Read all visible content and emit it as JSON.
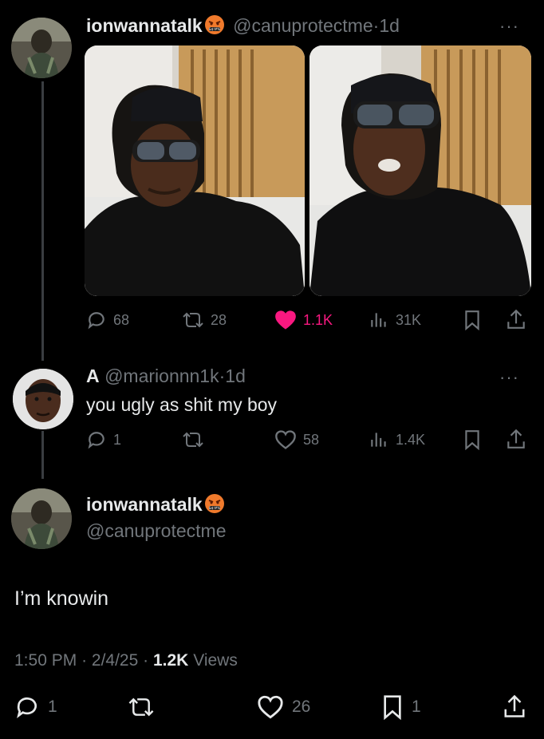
{
  "tweet1": {
    "display_name": "ionwannatalk",
    "handle": "@canuprotectme",
    "age": "1d",
    "more": "···",
    "stats": {
      "replies": "68",
      "retweets": "28",
      "likes": "1.1K",
      "views": "31K"
    }
  },
  "reply": {
    "display_name": "A",
    "handle": "@marionnn1k",
    "age": "1d",
    "more": "···",
    "text": "you ugly as shit my boy",
    "stats": {
      "replies": "1",
      "retweets": "",
      "likes": "58",
      "views": "1.4K"
    }
  },
  "main": {
    "display_name": "ionwannatalk",
    "handle": "@canuprotectme",
    "text": "I’m knowin",
    "time": "1:50 PM",
    "date": "2/4/25",
    "views_count": "1.2K",
    "views_label": "Views",
    "stats": {
      "replies": "1",
      "likes": "26",
      "bookmarks": "1"
    }
  },
  "separator": "·",
  "colors": {
    "like_pink": "#f91880",
    "muted": "#71767b",
    "text": "#e7e9ea",
    "emoji_orange": "#f07a2c"
  },
  "icons": [
    "reply-icon",
    "retweet-icon",
    "heart-icon",
    "views-icon",
    "bookmark-icon",
    "share-icon",
    "angry-emoji-icon",
    "more-icon"
  ]
}
